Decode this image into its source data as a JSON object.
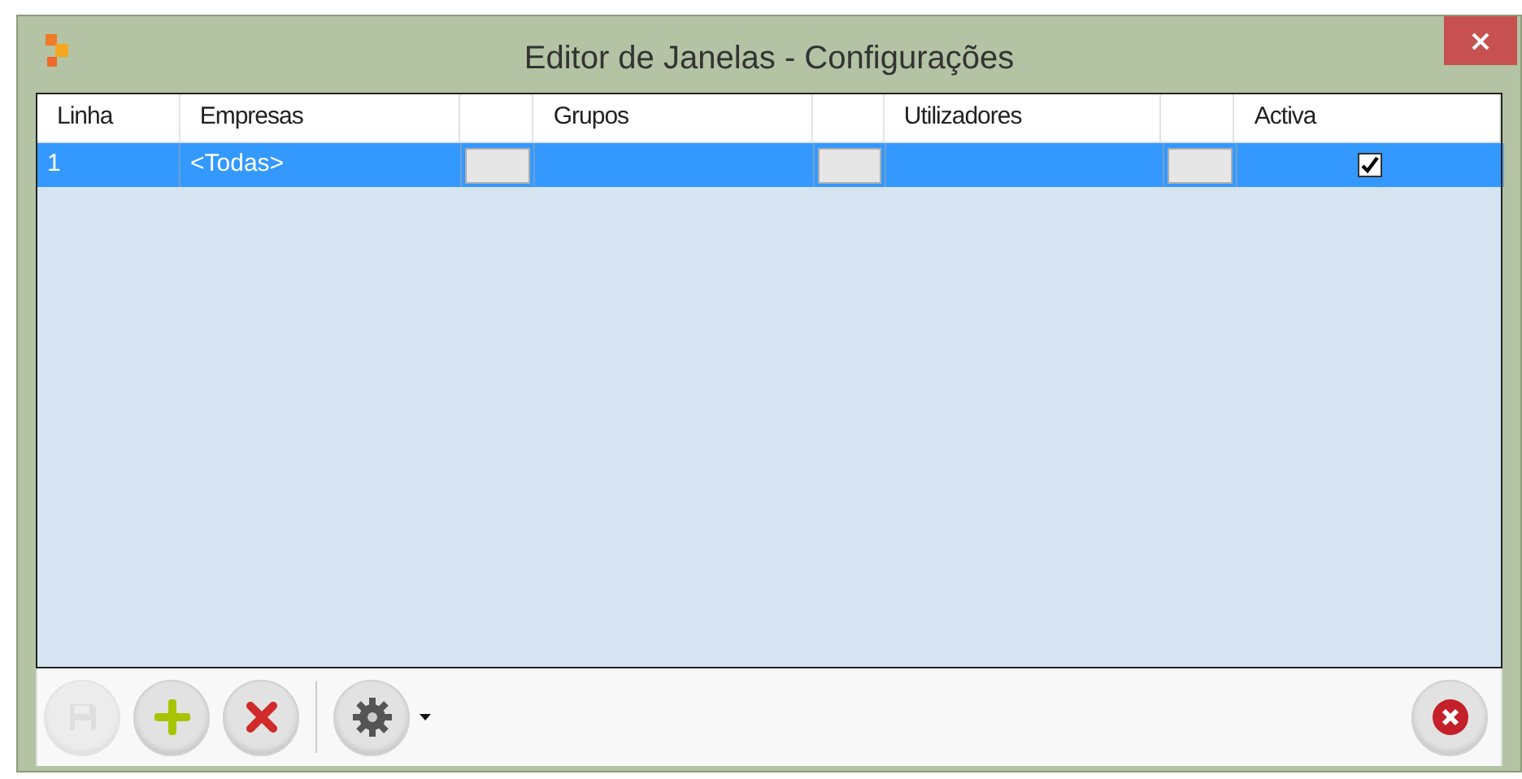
{
  "window": {
    "title": "Editor de Janelas - Configurações"
  },
  "table": {
    "columns": [
      {
        "kind": "text",
        "label": "Linha"
      },
      {
        "kind": "text",
        "label": "Empresas"
      },
      {
        "kind": "button"
      },
      {
        "kind": "text",
        "label": "Grupos"
      },
      {
        "kind": "button"
      },
      {
        "kind": "text",
        "label": "Utilizadores"
      },
      {
        "kind": "button"
      },
      {
        "kind": "text",
        "label": "Activa"
      }
    ],
    "rows": [
      {
        "selected": true,
        "cells": [
          {
            "kind": "text",
            "text": "1"
          },
          {
            "kind": "text",
            "text": "<Todas>"
          },
          {
            "kind": "button"
          },
          {
            "kind": "text"
          },
          {
            "kind": "button"
          },
          {
            "kind": "text"
          },
          {
            "kind": "button"
          },
          {
            "kind": "check",
            "checked": true
          }
        ]
      }
    ]
  },
  "toolbar": {
    "left": [
      {
        "kind": "save",
        "disabled": true
      },
      {
        "kind": "add",
        "disabled": false
      },
      {
        "kind": "delete",
        "disabled": false
      },
      {
        "kind": "settings",
        "disabled": false,
        "dropdown": true
      }
    ],
    "right": [
      {
        "kind": "close",
        "disabled": false
      }
    ]
  }
}
